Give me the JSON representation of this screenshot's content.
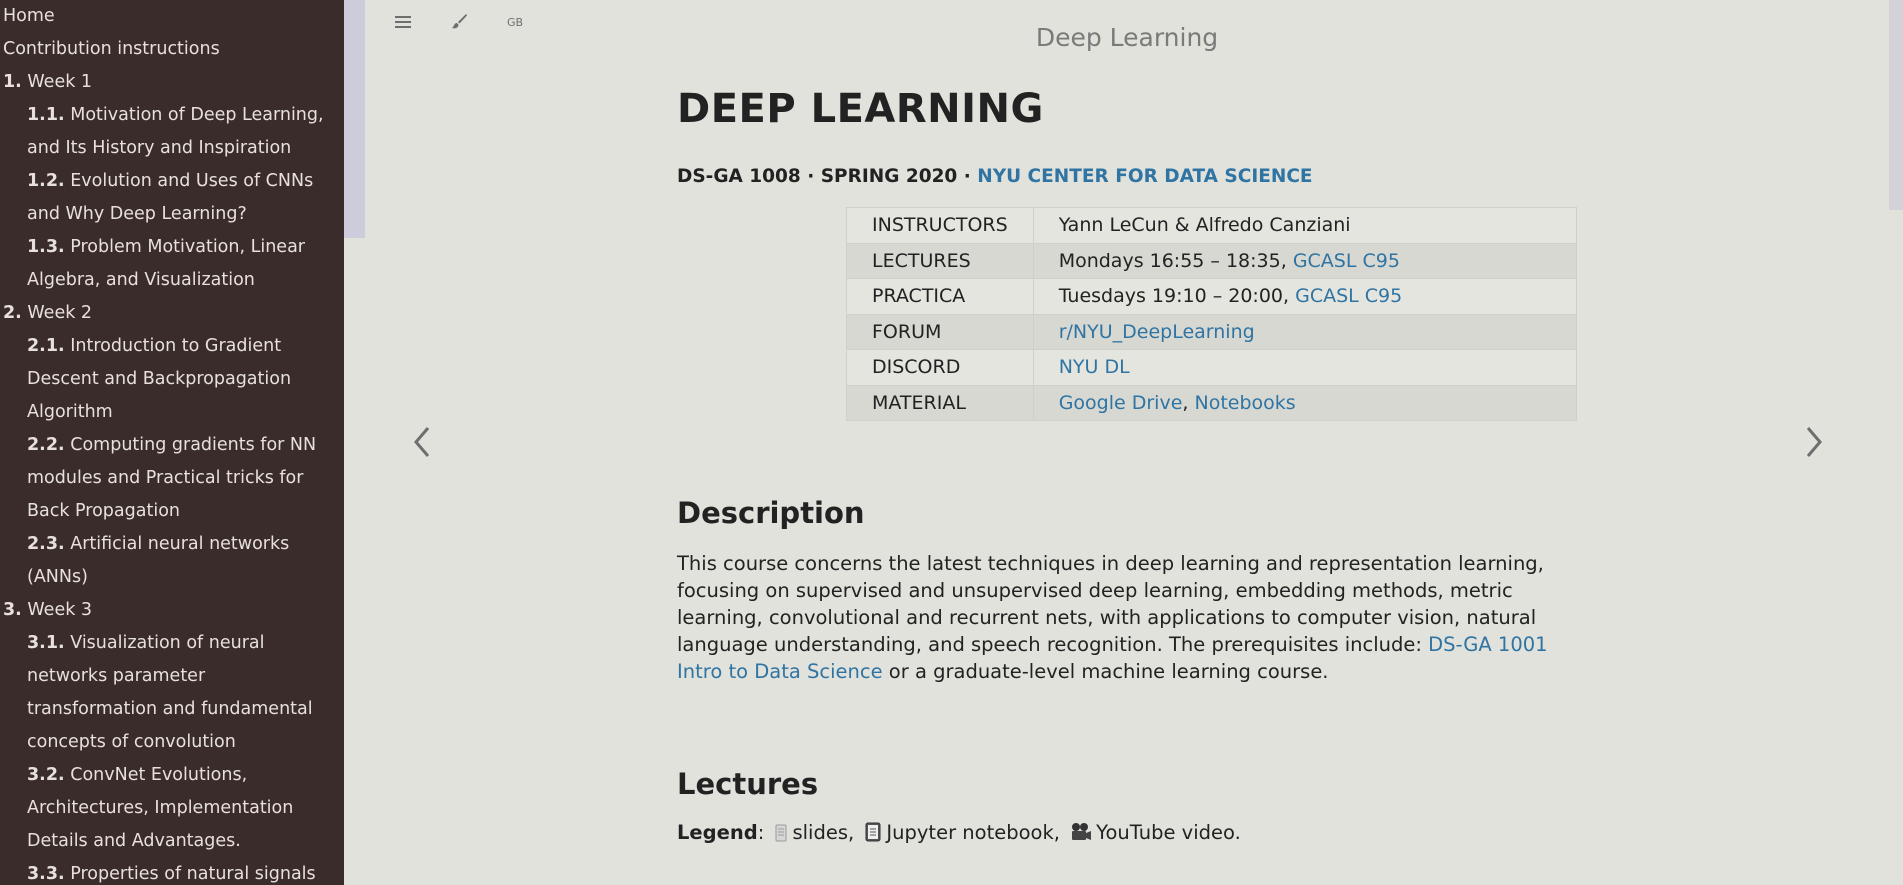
{
  "sidebar": {
    "items": [
      {
        "num": "",
        "label": "Home",
        "sub": false
      },
      {
        "num": "",
        "label": "Contribution instructions",
        "sub": false
      },
      {
        "num": "1.",
        "label": "Week 1",
        "sub": false
      },
      {
        "num": "1.1.",
        "label": "Motivation of Deep Learning, and Its History and Inspiration",
        "sub": true
      },
      {
        "num": "1.2.",
        "label": "Evolution and Uses of CNNs and Why Deep Learning?",
        "sub": true
      },
      {
        "num": "1.3.",
        "label": "Problem Motivation, Linear Algebra, and Visualization",
        "sub": true
      },
      {
        "num": "2.",
        "label": "Week 2",
        "sub": false
      },
      {
        "num": "2.1.",
        "label": "Introduction to Gradient Descent and Backpropagation Algorithm",
        "sub": true
      },
      {
        "num": "2.2.",
        "label": "Computing gradients for NN modules and Practical tricks for Back Propagation",
        "sub": true
      },
      {
        "num": "2.3.",
        "label": "Artificial neural networks (ANNs)",
        "sub": true
      },
      {
        "num": "3.",
        "label": "Week 3",
        "sub": false
      },
      {
        "num": "3.1.",
        "label": "Visualization of neural networks parameter transformation and fundamental concepts of convolution",
        "sub": true
      },
      {
        "num": "3.2.",
        "label": "ConvNet Evolutions, Architectures, Implementation Details and Advantages.",
        "sub": true
      },
      {
        "num": "3.3.",
        "label": "Properties of natural signals",
        "sub": true
      }
    ]
  },
  "toolbar": {
    "menu_icon": "hamburger-icon",
    "theme_icon": "brush-icon",
    "lang_label": "GB"
  },
  "header": {
    "book_title": "Deep Learning"
  },
  "page": {
    "title": "DEEP LEARNING",
    "subtitle_prefix": "DS-GA 1008 · SPRING 2020 · ",
    "subtitle_link": "NYU CENTER FOR DATA SCIENCE",
    "info": {
      "instructors_k": "INSTRUCTORS",
      "instructors_v": "Yann LeCun & Alfredo Canziani",
      "lectures_k": "LECTURES",
      "lectures_v": "Mondays 16:55 – 18:35, ",
      "lectures_link": "GCASL C95",
      "practica_k": "PRACTICA",
      "practica_v": "Tuesdays 19:10 – 20:00, ",
      "practica_link": "GCASL C95",
      "forum_k": "FORUM",
      "forum_link": "r/NYU_DeepLearning",
      "discord_k": "DISCORD",
      "discord_link": "NYU DL",
      "material_k": "MATERIAL",
      "material_link1": "Google Drive",
      "material_sep": ", ",
      "material_link2": "Notebooks"
    },
    "description_heading": "Description",
    "description_text": "This course concerns the latest techniques in deep learning and representation learning, focusing on supervised and unsupervised deep learning, embedding methods, metric learning, convolutional and recurrent nets, with applications to computer vision, natural language understanding, and speech recognition. The prerequisites include: ",
    "description_link": "DS-GA 1001 Intro to Data Science",
    "description_tail": " or a graduate-level machine learning course.",
    "lectures_heading": "Lectures",
    "legend_label": "Legend",
    "legend_colon": ":",
    "legend_slides": "slides,",
    "legend_notebook": "Jupyter notebook,",
    "legend_video": "YouTube video."
  },
  "colors": {
    "sidebar_bg": "#3a2c2a",
    "page_bg": "#e1e2dc",
    "link": "#2f74a3"
  }
}
